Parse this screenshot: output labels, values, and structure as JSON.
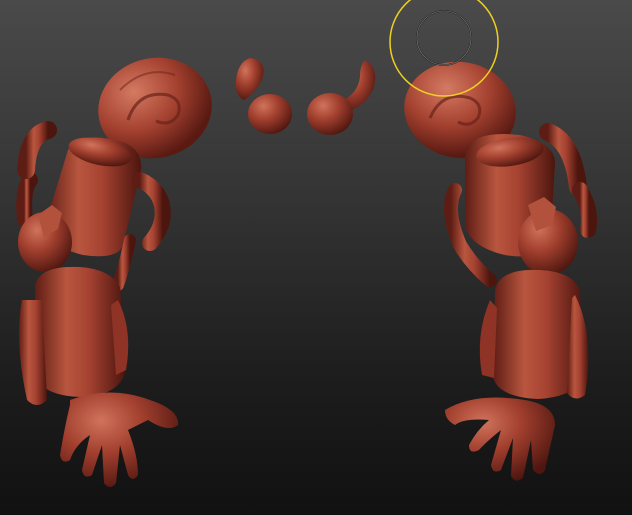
{
  "app": {
    "viewport_label": "",
    "background_top": "#4a4a4a",
    "background_bottom": "#111111"
  },
  "model": {
    "material_color": "#9b3a2c",
    "material_shadow": "#5a1a12",
    "material_highlight": "#c8654f",
    "parts": [
      "head-left",
      "arm-left",
      "horn-left",
      "horn-right",
      "head-right",
      "arm-right"
    ]
  },
  "brush": {
    "cursor_color": "#f0d020",
    "type": "circle-brush-cursor"
  }
}
